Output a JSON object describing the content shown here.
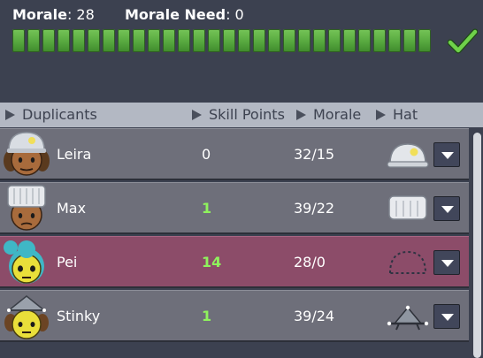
{
  "morale": {
    "label": "Morale",
    "value": "28",
    "need_label": "Morale Need",
    "need_value": "0",
    "segments": 28,
    "status_icon": "checkmark-icon",
    "bar_color": "#5fb14a"
  },
  "table": {
    "columns": [
      {
        "label": "Duplicants"
      },
      {
        "label": "Skill Points"
      },
      {
        "label": "Morale"
      },
      {
        "label": "Hat"
      }
    ],
    "rows": [
      {
        "name": "Leira",
        "skill_points": "0",
        "morale": "32/15",
        "hat": "hard-hat-icon",
        "selected": false
      },
      {
        "name": "Max",
        "skill_points": "1",
        "morale": "39/22",
        "hat": "chef-hat-icon",
        "selected": false
      },
      {
        "name": "Pei",
        "skill_points": "14",
        "morale": "28/0",
        "hat": "empty-hat-slot-icon",
        "selected": true
      },
      {
        "name": "Stinky",
        "skill_points": "1",
        "morale": "39/24",
        "hat": "tinker-hat-icon",
        "selected": false
      }
    ]
  },
  "colors": {
    "background": "#3c4150",
    "header_bar": "#b3b8c3",
    "row": "#6e6f7a",
    "selected_row": "#8c4c69",
    "skill_highlight": "#8ff25d"
  }
}
